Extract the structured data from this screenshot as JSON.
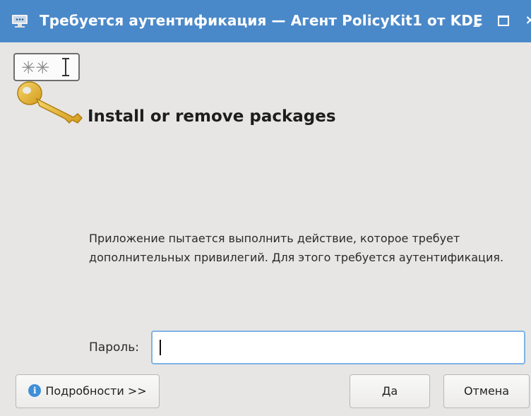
{
  "window": {
    "title": "Требуется аутентификация — Агент PolicyKit1 от KDE",
    "minimize_glyph": "_",
    "close_glyph": "×"
  },
  "icons": {
    "title_icon": "auth-agent-icon",
    "key_icon": "key-password-icon",
    "info_icon": "info-icon"
  },
  "dialog": {
    "heading": "Install or remove packages",
    "message": "Приложение пытается выполнить действие, которое требует дополнительных привилегий. Для этого требуется аутентификация.",
    "password_label": "Пароль:",
    "password_value": ""
  },
  "buttons": {
    "details": "Подробности >>",
    "yes": "Да",
    "cancel": "Отмена"
  },
  "colors": {
    "titlebar": "#4a89c9",
    "focus_border": "#7fb2e4"
  }
}
